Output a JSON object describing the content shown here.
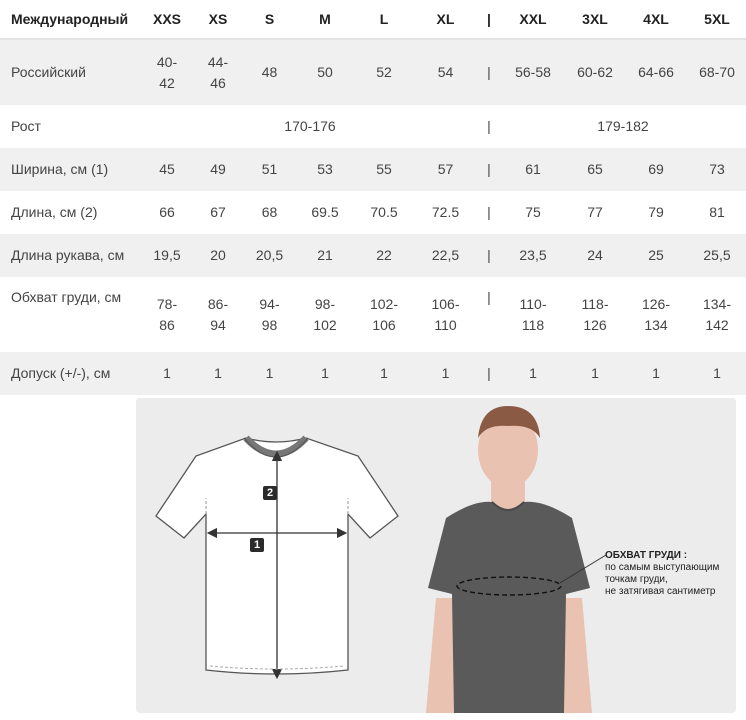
{
  "columns": [
    "Международный",
    "XXS",
    "XS",
    "S",
    "M",
    "L",
    "XL",
    "|",
    "XXL",
    "3XL",
    "4XL",
    "5XL"
  ],
  "rows": {
    "russian": {
      "label": "Российский",
      "cells": [
        [
          "40-",
          "42"
        ],
        [
          "44-",
          "46"
        ],
        "48",
        "50",
        "52",
        "54",
        "|",
        "56-58",
        "60-62",
        "64-66",
        "68-70"
      ]
    },
    "height": {
      "label": "Рост",
      "left_value": "170-176",
      "separator": "|",
      "right_value": "179-182"
    },
    "width": {
      "label": "Ширина, см (1)",
      "cells": [
        "45",
        "49",
        "51",
        "53",
        "55",
        "57",
        "|",
        "61",
        "65",
        "69",
        "73"
      ]
    },
    "length": {
      "label": "Длина, см (2)",
      "cells": [
        "66",
        "67",
        "68",
        "69.5",
        "70.5",
        "72.5",
        "|",
        "75",
        "77",
        "79",
        "81"
      ]
    },
    "sleeve": {
      "label": "Длина рукава, см",
      "cells": [
        "19,5",
        "20",
        "20,5",
        "21",
        "22",
        "22,5",
        "|",
        "23,5",
        "24",
        "25",
        "25,5"
      ]
    },
    "chest": {
      "label": "Обхват груди, см",
      "cells": [
        [
          "78-",
          "86"
        ],
        [
          "86-",
          "94"
        ],
        [
          "94-",
          "98"
        ],
        [
          "98-",
          "102"
        ],
        [
          "102-",
          "106"
        ],
        [
          "106-",
          "110"
        ],
        "|",
        [
          "110-",
          "118"
        ],
        [
          "118-",
          "126"
        ],
        [
          "126-",
          "134"
        ],
        [
          "134-",
          "142"
        ]
      ]
    },
    "tolerance": {
      "label": "Допуск (+/-), см",
      "cells": [
        "1",
        "1",
        "1",
        "1",
        "1",
        "1",
        "|",
        "1",
        "1",
        "1",
        "1"
      ]
    }
  },
  "figure": {
    "badge_width": "1",
    "badge_length": "2",
    "chest_note": {
      "title": "ОБХВАТ ГРУДИ :",
      "lines": [
        "по самым выступающим",
        "точкам груди,",
        "не затягивая сантиметр"
      ]
    }
  },
  "colors": {
    "row_gray": "#f0f0f0",
    "panel_bg": "#ececec",
    "shirt_dark": "#5a5a5a",
    "skin": "#e9c2b2",
    "hair": "#8a5a44"
  }
}
